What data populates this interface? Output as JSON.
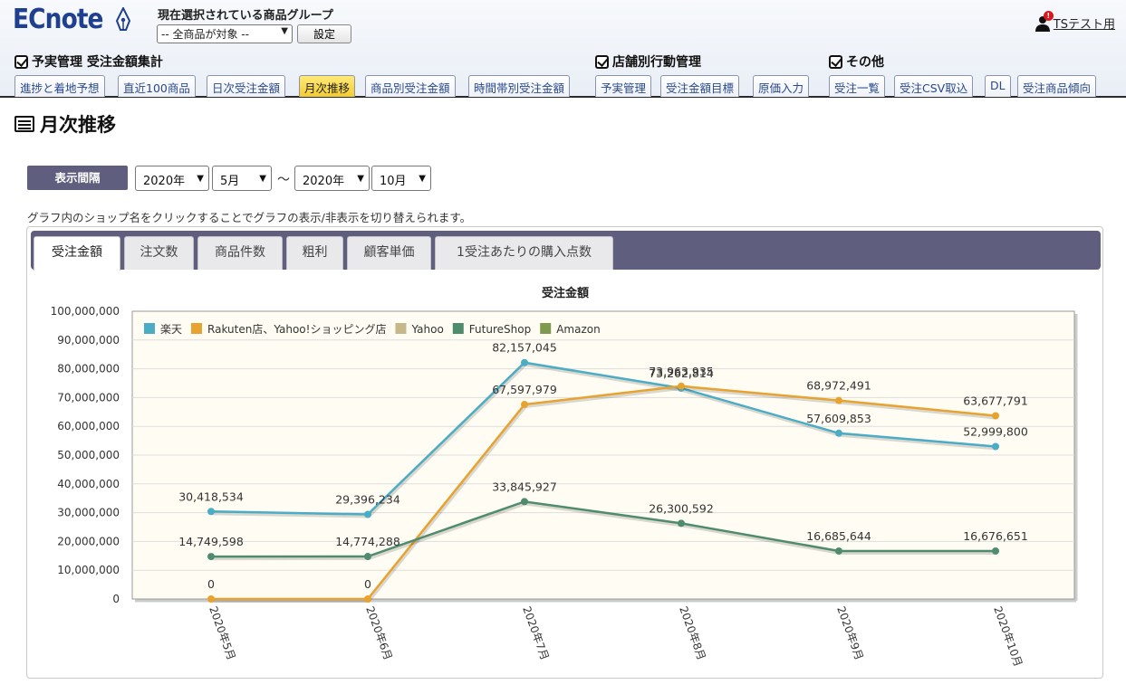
{
  "header": {
    "logo": "ECnote",
    "group_label": "現在選択されている商品グループ",
    "group_select": "-- 全商品が対象 --",
    "set_button": "設定",
    "user_name": "TSテスト用",
    "user_alert": "!"
  },
  "sections": [
    {
      "title": "予実管理 受注金額集計"
    },
    {
      "title": "店舗別行動管理"
    },
    {
      "title": "その他"
    }
  ],
  "nav": {
    "sales": [
      "進捗と着地予想",
      "直近100商品",
      "日次受注金額",
      "月次推移",
      "商品別受注金額",
      "時間帯別受注金額"
    ],
    "store": [
      "予実管理",
      "受注金額目標",
      "原価入力"
    ],
    "other": [
      "受注一覧",
      "受注CSV取込",
      "DL",
      "受注商品傾向"
    ],
    "active": "月次推移"
  },
  "page_title": "月次推移",
  "period": {
    "label": "表示間隔",
    "from_year": "2020年",
    "from_month": "5月",
    "separator": "～",
    "to_year": "2020年",
    "to_month": "10月"
  },
  "hint": "グラフ内のショップ名をクリックすることでグラフの表示/非表示を切り替えられます。",
  "chart_tabs": [
    "受注金額",
    "注文数",
    "商品件数",
    "粗利",
    "顧客単価",
    "1受注あたりの購入点数"
  ],
  "active_chart_tab": "受注金額",
  "chart_data": {
    "type": "line",
    "title": "受注金額",
    "categories": [
      "2020年5月",
      "2020年6月",
      "2020年7月",
      "2020年8月",
      "2020年9月",
      "2020年10月"
    ],
    "ylim": [
      0,
      100000000
    ],
    "yticks": [
      0,
      10000000,
      20000000,
      30000000,
      40000000,
      50000000,
      60000000,
      70000000,
      80000000,
      90000000,
      100000000
    ],
    "ytick_labels": [
      "0",
      "10,000,000",
      "20,000,000",
      "30,000,000",
      "40,000,000",
      "50,000,000",
      "60,000,000",
      "70,000,000",
      "80,000,000",
      "90,000,000",
      "100,000,000"
    ],
    "grid": true,
    "legend_position": "top-left",
    "series": [
      {
        "name": "楽天",
        "color": "#4aacc5",
        "values": [
          30418534,
          29396234,
          82157045,
          73262814,
          57609853,
          52999800
        ],
        "labels": [
          "30,418,534",
          "29,396,234",
          "82,157,045",
          "73,262,814",
          "57,609,853",
          "52,999,800"
        ]
      },
      {
        "name": "Rakuten店、Yahoo!ショッピング店",
        "color": "#e8a22f",
        "values": [
          0,
          0,
          67597979,
          73963935,
          68972491,
          63677791
        ],
        "labels": [
          "0",
          "0",
          "67,597,979",
          "73,963,935",
          "68,972,491",
          "63,677,791"
        ]
      },
      {
        "name": "Yahoo",
        "color": "#c6b88a",
        "values": null,
        "labels": null
      },
      {
        "name": "FutureShop",
        "color": "#4f8c6e",
        "values": [
          14749598,
          14774288,
          33845927,
          26300592,
          16685644,
          16676651
        ],
        "labels": [
          "14,749,598",
          "14,774,288",
          "33,845,927",
          "26,300,592",
          "16,685,644",
          "16,676,651"
        ]
      },
      {
        "name": "Amazon",
        "color": "#7f9a4f",
        "values": null,
        "labels": null
      }
    ]
  }
}
